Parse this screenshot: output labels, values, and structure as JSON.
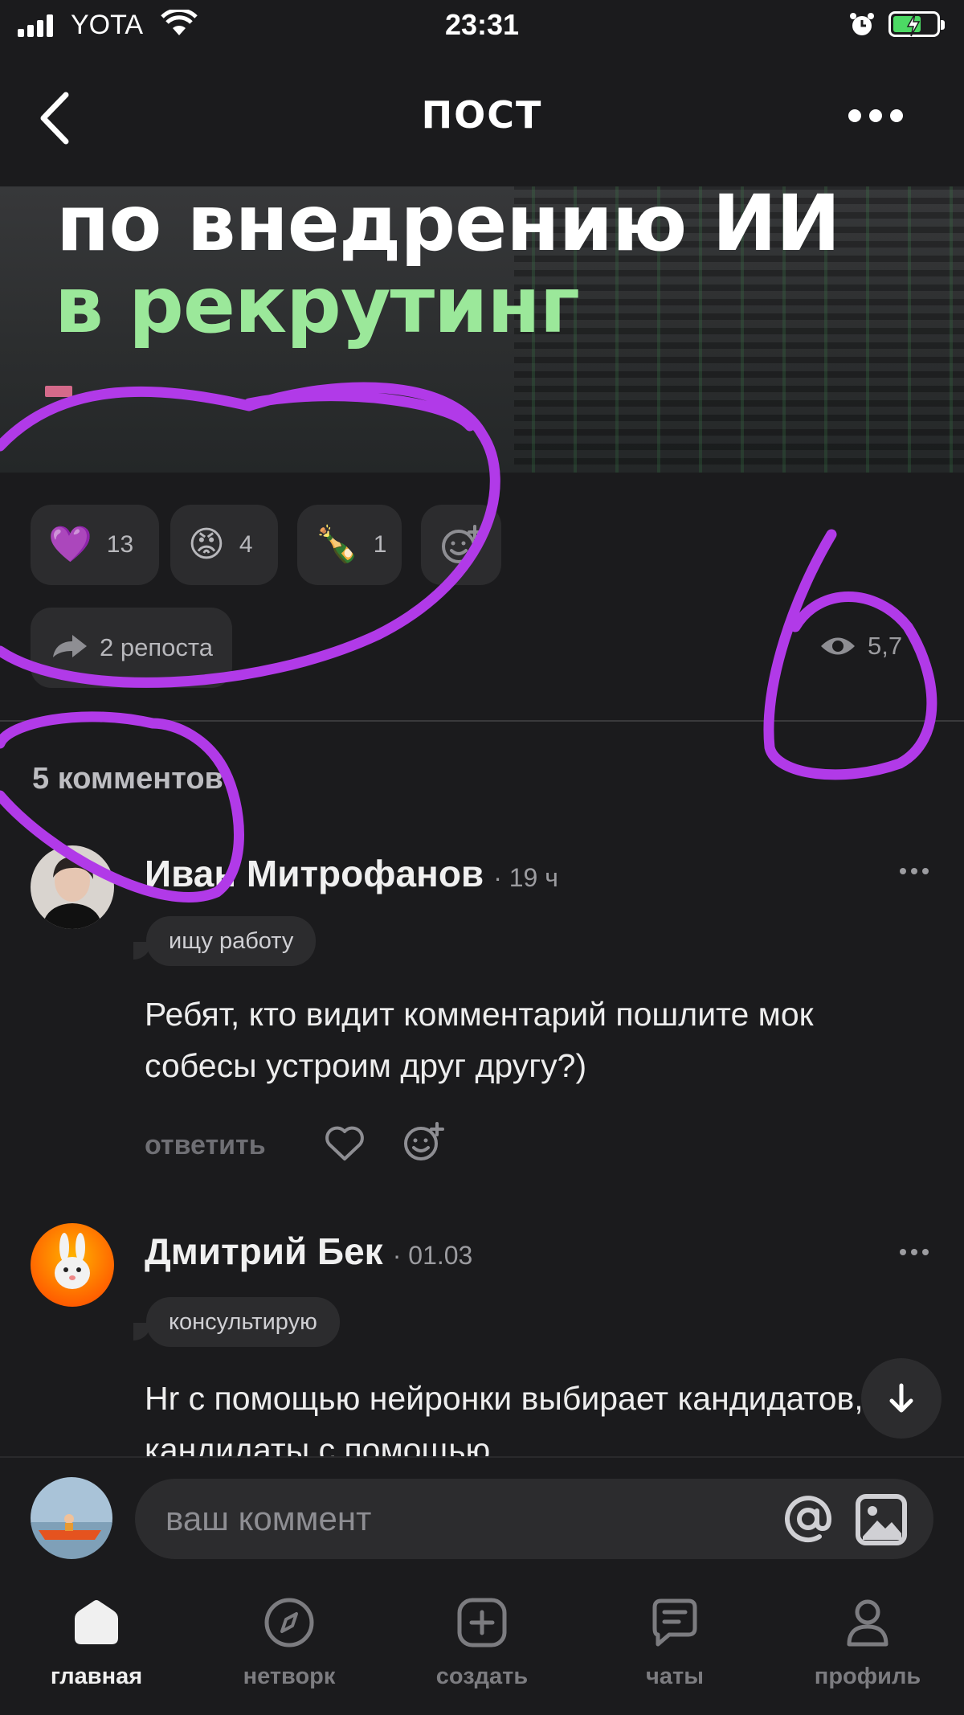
{
  "status_bar": {
    "carrier": "YOTA",
    "time": "23:31"
  },
  "nav": {
    "title": "ПОСТ"
  },
  "banner": {
    "line1": "по внедрению ИИ",
    "line2": "в рекрутинг"
  },
  "reactions": [
    {
      "emoji": "💜",
      "count": "13"
    },
    {
      "emoji": "😡",
      "count": "4"
    },
    {
      "emoji": "🍾",
      "count": "1"
    }
  ],
  "reposts": "2 репоста",
  "views": "5,7",
  "comments_count": "5 комментов",
  "comments": [
    {
      "author": "Иван Митрофанов",
      "time": "· 19 ч",
      "tag": "ищу работу",
      "text": "Ребят, кто видит комментарий пошлите мок собесы устроим друг другу?)",
      "reply": "ответить"
    },
    {
      "author": "Дмитрий Бек",
      "time": "· 01.03",
      "tag": "консультирую",
      "text": "Hr с помощью нейронки выбирает кандидатов, кандидаты с помощью"
    }
  ],
  "comment_input": {
    "placeholder": "ваш коммент"
  },
  "tabs": [
    {
      "label": "главная"
    },
    {
      "label": "нетворк"
    },
    {
      "label": "создать"
    },
    {
      "label": "чаты"
    },
    {
      "label": "профиль"
    }
  ],
  "colors": {
    "background": "#1b1b1d",
    "chip": "#2c2c2e",
    "accent_green": "#9be89a",
    "annotation": "#b13ae8"
  }
}
